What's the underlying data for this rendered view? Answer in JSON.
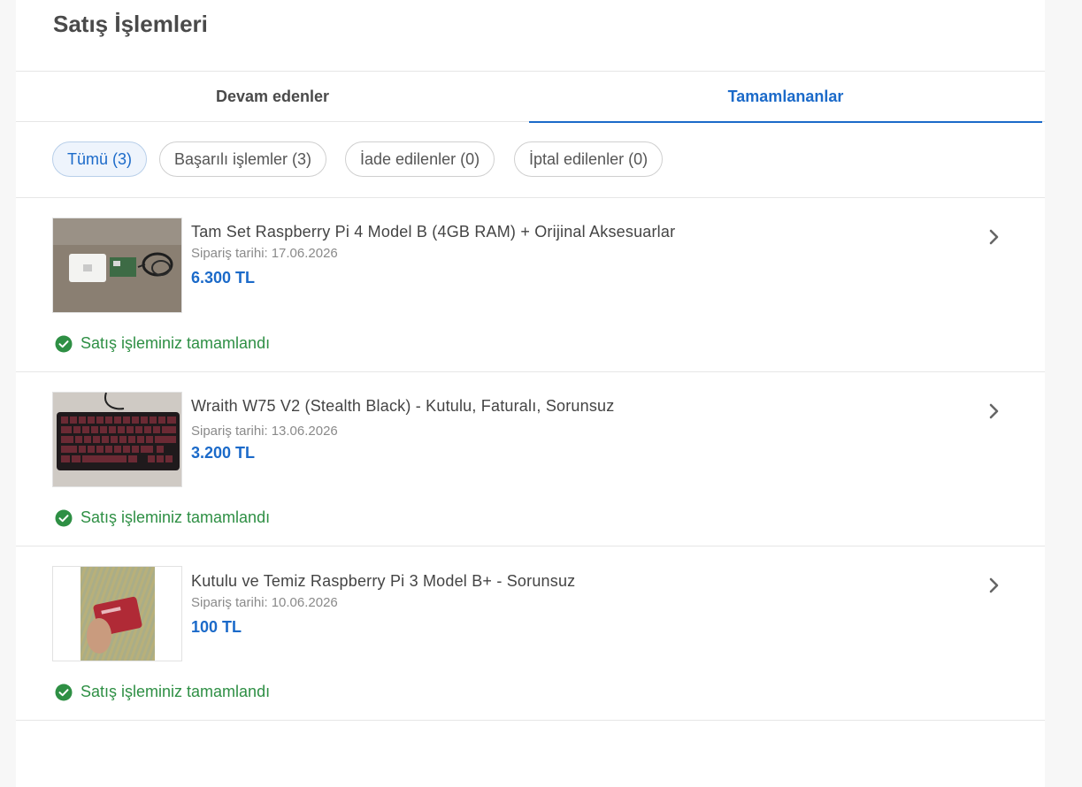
{
  "page": {
    "title": "Satış İşlemleri"
  },
  "tabs": [
    {
      "label": "Devam edenler",
      "active": false
    },
    {
      "label": "Tamamlananlar",
      "active": true
    }
  ],
  "filters": [
    {
      "label": "Tümü (3)",
      "active": true
    },
    {
      "label": "Başarılı işlemler (3)",
      "active": false
    },
    {
      "label": "İade edilenler (0)",
      "active": false
    },
    {
      "label": "İptal edilenler (0)",
      "active": false
    }
  ],
  "orders": [
    {
      "title": "Tam Set Raspberry Pi 4 Model B (4GB RAM) + Orijinal Aksesuarlar",
      "date_label": "Sipariş tarihi:",
      "date": "17.06.2026",
      "price": "6.300 TL",
      "status": "Satış işleminiz tamamlandı"
    },
    {
      "title": "Wraith W75 V2 (Stealth Black) - Kutulu, Faturalı, Sorunsuz",
      "date_label": "Sipariş tarihi:",
      "date": "13.06.2026",
      "price": "3.200 TL",
      "status": "Satış işleminiz tamamlandı"
    },
    {
      "title": "Kutulu ve Temiz Raspberry Pi 3 Model B+ - Sorunsuz",
      "date_label": "Sipariş tarihi:",
      "date": "10.06.2026",
      "price": "100 TL",
      "status": "Satış işleminiz tamamlandı"
    }
  ],
  "icons": {
    "chevron": "chevron-right-icon",
    "status": "check-circle-icon"
  },
  "colors": {
    "accent": "#1b6ac9",
    "success": "#2e8f44"
  }
}
